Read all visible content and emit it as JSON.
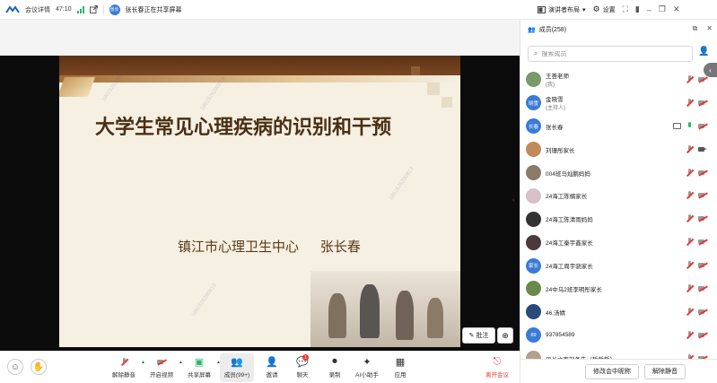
{
  "topbar": {
    "meeting_details": "会议详情",
    "elapsed": "47:10",
    "share_badge": "张长",
    "share_status": "张长春正在共享屏幕"
  },
  "topright": {
    "layout_label": "演讲者布局",
    "settings_label": "设置"
  },
  "slide": {
    "title": "大学生常见心理疾病的识别和干预",
    "org": "镇江市心理卫生中心",
    "presenter": "张长春",
    "watermark": "1861526290813"
  },
  "stage_buttons": {
    "annotate": "批注"
  },
  "toolbar": {
    "items": [
      {
        "label": "解除静音",
        "icon": "mic-off-icon"
      },
      {
        "label": "开启视频",
        "icon": "camera-off-icon"
      },
      {
        "label": "共享屏幕",
        "icon": "share-screen-icon"
      },
      {
        "label": "成员(99+)",
        "icon": "members-icon"
      },
      {
        "label": "邀请",
        "icon": "invite-icon"
      },
      {
        "label": "聊天",
        "icon": "chat-icon",
        "badge": "1"
      },
      {
        "label": "录制",
        "icon": "record-icon"
      },
      {
        "label": "AI小助手",
        "icon": "ai-assistant-icon"
      },
      {
        "label": "应用",
        "icon": "apps-icon"
      },
      {
        "label": "离开会议",
        "icon": "leave-icon"
      }
    ]
  },
  "panel": {
    "title": "成员(258)",
    "search_placeholder": "搜索成员",
    "members": [
      {
        "name": "王荟老师",
        "role": "(我)",
        "avatar_text": "",
        "avatar_color": "#7a9a6a",
        "mic": "off",
        "cam": "off",
        "screen": false
      },
      {
        "name": "金晓雪",
        "role": "(主持人)",
        "avatar_text": "晓雪",
        "avatar_color": "#3b7bd8",
        "mic": "off",
        "cam": "off",
        "screen": false
      },
      {
        "name": "张长春",
        "role": "",
        "avatar_text": "长春",
        "avatar_color": "#3b7bd8",
        "mic": "on",
        "cam": "off",
        "screen": true
      },
      {
        "name": "刘珊彤家长",
        "role": "",
        "avatar_text": "",
        "avatar_color": "#c08a5a",
        "mic": "off",
        "cam": "on",
        "screen": false
      },
      {
        "name": "004班马灿鹏妈妈",
        "role": "",
        "avatar_text": "",
        "avatar_color": "#8a7a6a",
        "mic": "off",
        "cam": "off",
        "screen": false
      },
      {
        "name": "24海工陈楠家长",
        "role": "",
        "avatar_text": "",
        "avatar_color": "#d8c0c8",
        "mic": "off",
        "cam": "off",
        "screen": false
      },
      {
        "name": "24海工陈清雨妈妈",
        "role": "",
        "avatar_text": "",
        "avatar_color": "#333333",
        "mic": "off",
        "cam": "off",
        "screen": false
      },
      {
        "name": "24海工秦宇鑫家长",
        "role": "",
        "avatar_text": "",
        "avatar_color": "#4a3a3a",
        "mic": "off",
        "cam": "off",
        "screen": false
      },
      {
        "name": "24海工周宇骁家长",
        "role": "",
        "avatar_text": "家长",
        "avatar_color": "#3b7bd8",
        "mic": "off",
        "cam": "off",
        "screen": false
      },
      {
        "name": "24中乌2班李明彤家长",
        "role": "",
        "avatar_text": "",
        "avatar_color": "#6a8a4a",
        "mic": "off",
        "cam": "off",
        "screen": false
      },
      {
        "name": "46.汤婧",
        "role": "",
        "avatar_text": "",
        "avatar_color": "#2a4a7a",
        "mic": "off",
        "cam": "off",
        "screen": false
      },
      {
        "name": "937854589",
        "role": "",
        "avatar_text": "89",
        "avatar_color": "#3b7bd8",
        "mic": "off",
        "cam": "off",
        "screen": false
      },
      {
        "name": "贝长之李刘备先（哲哲哲）",
        "role": "",
        "avatar_text": "",
        "avatar_color": "#b0a090",
        "mic": "off",
        "cam": "off",
        "screen": false
      }
    ],
    "rename_button": "修改会中昵称",
    "unmute_button": "解除静音"
  }
}
